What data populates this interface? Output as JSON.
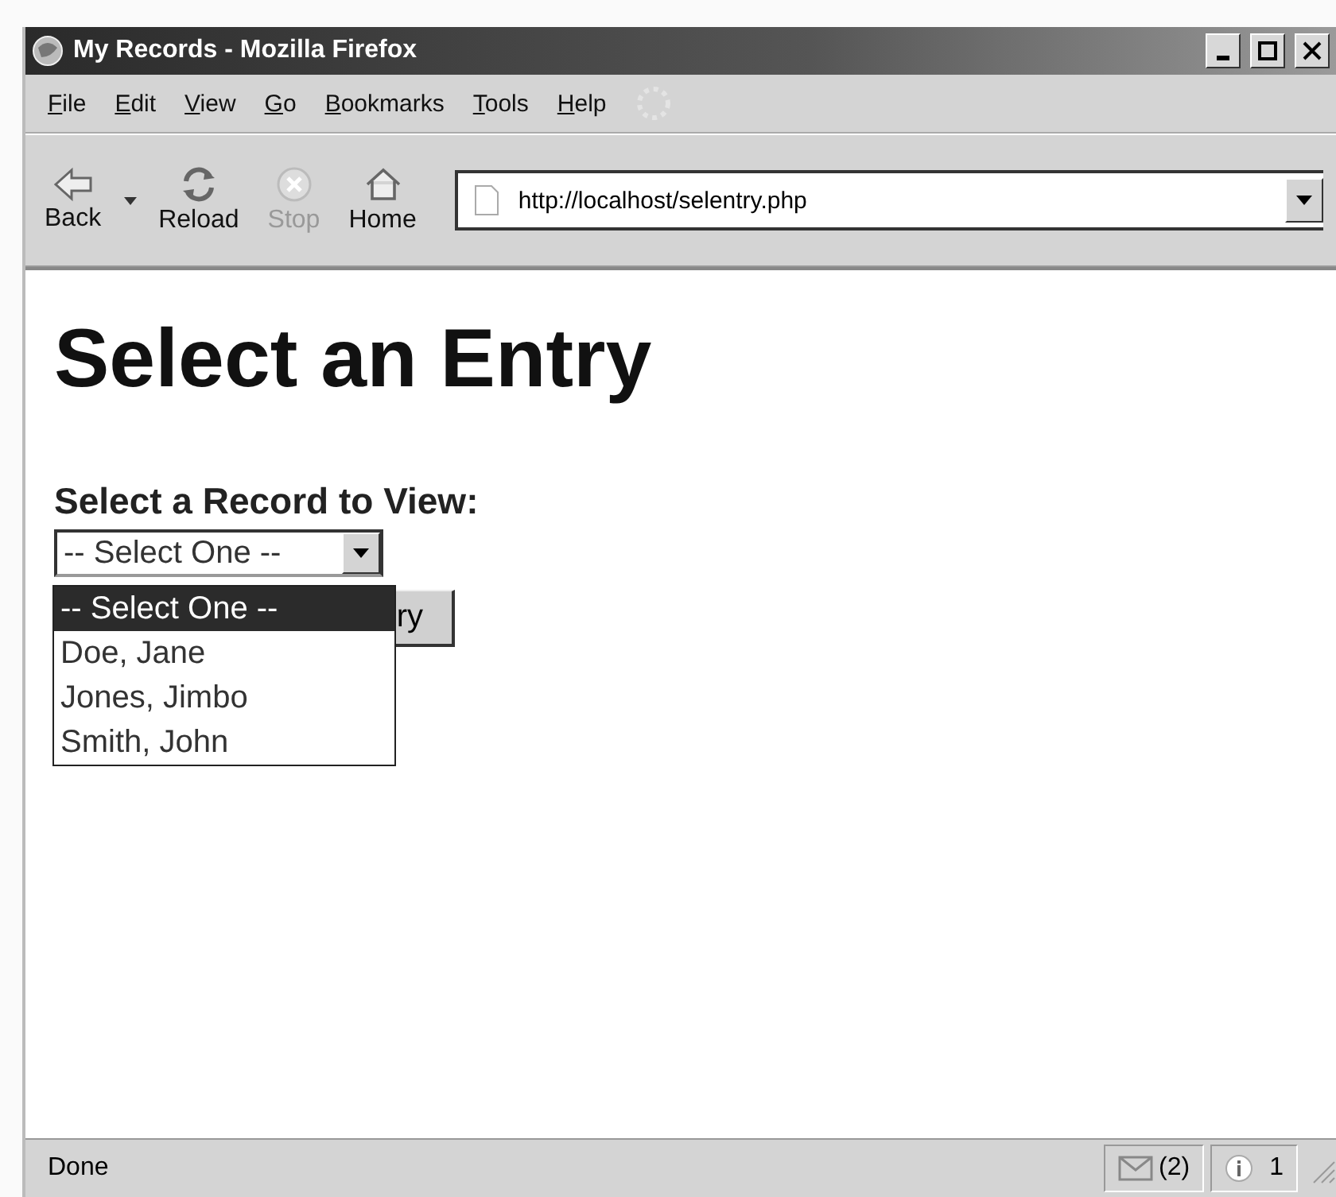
{
  "window": {
    "title": "My Records - Mozilla Firefox"
  },
  "menu": [
    "File",
    "Edit",
    "View",
    "Go",
    "Bookmarks",
    "Tools",
    "Help"
  ],
  "toolbar": [
    {
      "kind": "back",
      "label": "Back",
      "disabled": false
    },
    {
      "kind": "reload",
      "label": "Reload",
      "disabled": false
    },
    {
      "kind": "stop",
      "label": "Stop",
      "disabled": true
    },
    {
      "kind": "home",
      "label": "Home",
      "disabled": false
    }
  ],
  "address": {
    "value": "http://localhost/selentry.php"
  },
  "page": {
    "heading": "Select an Entry",
    "label": "Select a Record to View:",
    "select_value": "-- Select One --",
    "options": [
      {
        "label": "-- Select One --",
        "selected": true
      },
      {
        "label": "Doe, Jane",
        "selected": false
      },
      {
        "label": "Jones, Jimbo",
        "selected": false
      },
      {
        "label": "Smith, John",
        "selected": false
      }
    ],
    "button_visible_text": "ry"
  },
  "status_bar": {
    "text": "Done",
    "mail_count": "(2)",
    "info_count": "1"
  }
}
